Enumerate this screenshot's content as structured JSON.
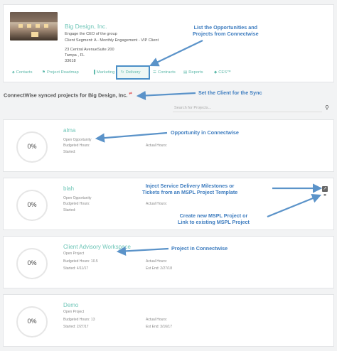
{
  "client": {
    "name": "Big Design, Inc.",
    "lines": [
      "Engage the CEO of the group",
      "Client Segment: A - Monthly Engagement - VIP Client"
    ],
    "address": [
      "23 Central AvenueSuite 200",
      "Tampa , FL",
      "33618"
    ],
    "tabs": [
      {
        "label": "Contacts",
        "icon": "person-icon",
        "glyph": "♣"
      },
      {
        "label": "Project Roadmap",
        "icon": "roadmap-icon",
        "glyph": "⚑"
      },
      {
        "label": "Marketing",
        "icon": "bar-chart-icon",
        "glyph": "▐"
      },
      {
        "label": "Delivery",
        "icon": "refresh-icon",
        "glyph": "↻"
      },
      {
        "label": "Contracts",
        "icon": "document-icon",
        "glyph": "☰"
      },
      {
        "label": "Reports",
        "icon": "reports-icon",
        "glyph": "▤"
      },
      {
        "label": "CES™",
        "icon": "diamond-icon",
        "glyph": "◆"
      }
    ]
  },
  "section": {
    "title": "ConnectWise synced projects for Big Design, Inc.",
    "sync_icon": "⇄",
    "search_placeholder": "Search for Projects..."
  },
  "projects": [
    {
      "name": "alma",
      "status": "Open Opportunity",
      "budgeted": "Budgeted Hours:",
      "started": "Started:",
      "actual": "Actual Hours:",
      "end": "",
      "progress": "0%"
    },
    {
      "name": "blah",
      "status": "Open Opportunity",
      "budgeted": "Budgeted Hours:",
      "started": "Started:",
      "actual": "Actual Hours:",
      "end": "",
      "progress": "0%"
    },
    {
      "name": "Client Advisory Workspace",
      "status": "Open Project",
      "budgeted": "Budgeted Hours: 10.5",
      "started": "Started: 4/11/17",
      "actual": "Actual Hours:",
      "end": "Est End: 2/27/18",
      "progress": "0%"
    },
    {
      "name": "Demo",
      "status": "Open Project",
      "budgeted": "Budgeted Hours: 13",
      "started": "Started: 2/27/17",
      "actual": "Actual Hours:",
      "end": "Est End: 3/16/17",
      "progress": "0%"
    }
  ],
  "annotations": {
    "list": [
      "List the Opportunities and",
      "Projects from Connectwise"
    ],
    "set_client": "Set the Client for the Sync",
    "opportunity": "Opportunity in Connectwise",
    "inject": [
      "Inject Service Delivery Milestones or",
      "Tickets from an MSPL  Project Template"
    ],
    "create": [
      "Create new MSPL Project or",
      "Link to existing MSPL Project"
    ],
    "project": "Project in Connectwise"
  },
  "colors": {
    "accent": "#6fc6b8",
    "annotation": "#3d7cbf",
    "highlight_box": "#4b8fc7"
  }
}
